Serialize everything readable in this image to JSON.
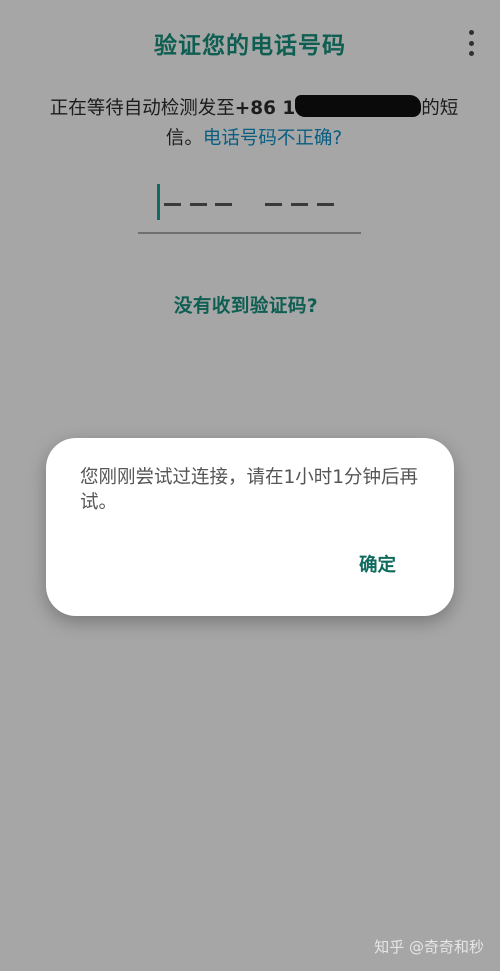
{
  "header": {
    "title": "验证您的电话号码",
    "menu_icon": "more-vertical-icon"
  },
  "sms_message": {
    "prefix": "正在等待自动检测发至",
    "phone_visible": "+86 1",
    "suffix": "的短信。",
    "wrong_number_link": "电话号码不正确?"
  },
  "code_input": {
    "dash_glyph": "–"
  },
  "resend_link": "没有收到验证码?",
  "dialog": {
    "message": "您刚刚尝试过连接，请在1小时1分钟后再试。",
    "ok_label": "确定"
  },
  "watermark": "知乎 @奇奇和秒",
  "colors": {
    "accent": "#0f5e52",
    "link": "#0a5e82",
    "overlay_bg": "#a6a6a6"
  }
}
